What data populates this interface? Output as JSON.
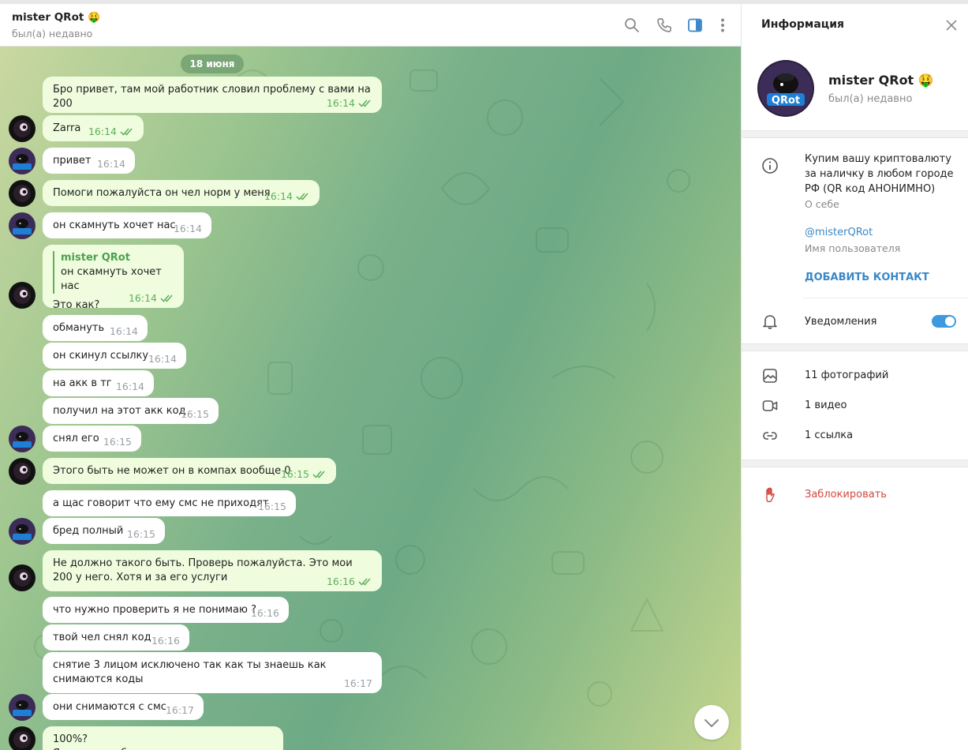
{
  "header": {
    "name": "mister QRot",
    "status": "был(а) недавно"
  },
  "date_pill": "18 июня",
  "messages": [
    {
      "dir": "out",
      "text": "Бро привет, там мой работник словил проблему с вами на 200",
      "time": "16:14"
    },
    {
      "dir": "out",
      "text": "Zarra",
      "time": "16:14"
    },
    {
      "dir": "in",
      "text": "привет",
      "time": "16:14"
    },
    {
      "dir": "out",
      "text": "Помоги пожалуйста он чел норм у меня",
      "time": "16:14"
    },
    {
      "dir": "in",
      "text": "он скамнуть хочет нас",
      "time": "16:14"
    },
    {
      "dir": "out",
      "quote_name": "mister QRot",
      "quote_text": "он скамнуть хочет нас",
      "text": "Это как?",
      "time": "16:14"
    },
    {
      "dir": "in",
      "text": "обмануть",
      "time": "16:14"
    },
    {
      "dir": "in",
      "text": "он скинул ссылку",
      "time": "16:14"
    },
    {
      "dir": "in",
      "text": "на  акк в тг",
      "time": "16:14"
    },
    {
      "dir": "in",
      "text": "получил на этот акк код",
      "time": "16:15"
    },
    {
      "dir": "in",
      "text": "снял его",
      "time": "16:15"
    },
    {
      "dir": "out",
      "text": "Этого быть не может он в компах вообще 0",
      "time": "16:15"
    },
    {
      "dir": "in",
      "text": "а щас говорит что ему смс не приходят",
      "time": "16:15"
    },
    {
      "dir": "in",
      "text": "бред полный",
      "time": "16:15"
    },
    {
      "dir": "out",
      "text": "Не должно такого быть. Проверь пожалуйста. Это мои 200 у него. Хотя и за его услуги",
      "time": "16:16"
    },
    {
      "dir": "in",
      "text": "что нужно проверить я не понимаю ?",
      "time": "16:16"
    },
    {
      "dir": "in",
      "text": "твой чел снял код",
      "time": "16:16"
    },
    {
      "dir": "in",
      "text": "снятие 3 лицом исключено так как ты знаешь как снимаются коды",
      "time": "16:17"
    },
    {
      "dir": "in",
      "text": "они снимаются с смс",
      "time": "16:17"
    },
    {
      "dir": "out",
      "text": "100%?",
      "time": ""
    }
  ],
  "last_partial": "Я сам не разб",
  "panel": {
    "title": "Информация",
    "name": "mister QRot",
    "status": "был(а) недавно",
    "bio": "Купим вашу криптовалюту за наличку в любом городе РФ (QR код АНОНИМНО)",
    "bio_label": "О себе",
    "username": "@misterQRot",
    "username_label": "Имя пользователя",
    "add_contact": "ДОБАВИТЬ КОНТАКТ",
    "notifications": "Уведомления",
    "notifications_on": true,
    "photos": "11 фотографий",
    "videos": "1 видео",
    "links": "1 ссылка",
    "block": "Заблокировать"
  },
  "colors": {
    "accent": "#3a88c6",
    "outgoing_bubble": "#effdde",
    "tick_green": "#5dae5c",
    "danger": "#d2473f"
  },
  "avatar_logo_text": "QRot"
}
